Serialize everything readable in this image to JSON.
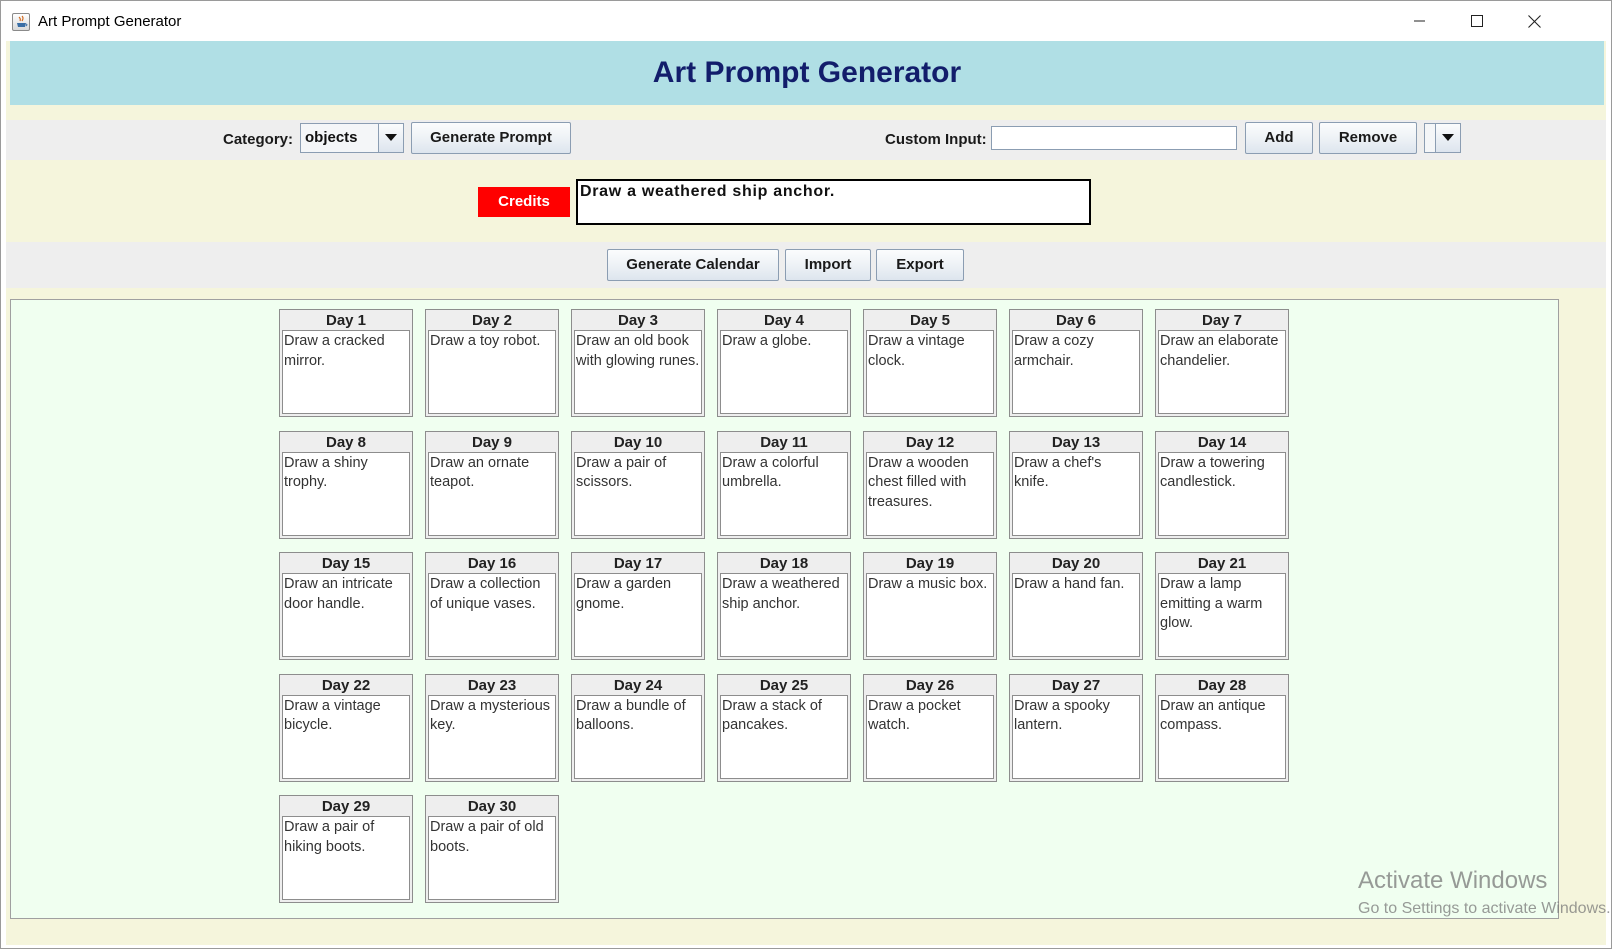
{
  "window": {
    "title": "Art Prompt Generator"
  },
  "header": {
    "title": "Art Prompt Generator"
  },
  "controls": {
    "category_label": "Category:",
    "category_value": "objects",
    "generate_prompt_label": "Generate Prompt",
    "custom_input_label": "Custom Input:",
    "custom_input_value": "",
    "add_label": "Add",
    "remove_label": "Remove"
  },
  "prompt": {
    "credits_label": "Credits",
    "text": "Draw a weathered ship anchor."
  },
  "actions": {
    "generate_calendar_label": "Generate Calendar",
    "import_label": "Import",
    "export_label": "Export"
  },
  "days": [
    {
      "title": "Day 1",
      "text": "Draw a cracked mirror."
    },
    {
      "title": "Day 2",
      "text": "Draw a toy robot."
    },
    {
      "title": "Day 3",
      "text": "Draw an old book with glowing runes."
    },
    {
      "title": "Day 4",
      "text": "Draw a globe."
    },
    {
      "title": "Day 5",
      "text": "Draw a vintage clock."
    },
    {
      "title": "Day 6",
      "text": "Draw a cozy armchair."
    },
    {
      "title": "Day 7",
      "text": "Draw an elaborate chandelier."
    },
    {
      "title": "Day 8",
      "text": "Draw a shiny trophy."
    },
    {
      "title": "Day 9",
      "text": "Draw an ornate teapot."
    },
    {
      "title": "Day 10",
      "text": "Draw a pair of scissors."
    },
    {
      "title": "Day 11",
      "text": "Draw a colorful umbrella."
    },
    {
      "title": "Day 12",
      "text": "Draw a wooden chest filled with treasures."
    },
    {
      "title": "Day 13",
      "text": "Draw a chef's knife."
    },
    {
      "title": "Day 14",
      "text": "Draw a towering candlestick."
    },
    {
      "title": "Day 15",
      "text": "Draw an intricate door handle."
    },
    {
      "title": "Day 16",
      "text": "Draw a collection of unique vases."
    },
    {
      "title": "Day 17",
      "text": "Draw a garden gnome."
    },
    {
      "title": "Day 18",
      "text": "Draw a weathered ship anchor."
    },
    {
      "title": "Day 19",
      "text": "Draw a music box."
    },
    {
      "title": "Day 20",
      "text": "Draw a hand fan."
    },
    {
      "title": "Day 21",
      "text": "Draw a lamp emitting a warm glow."
    },
    {
      "title": "Day 22",
      "text": "Draw a vintage bicycle."
    },
    {
      "title": "Day 23",
      "text": "Draw a mysterious key."
    },
    {
      "title": "Day 24",
      "text": "Draw a bundle of balloons."
    },
    {
      "title": "Day 25",
      "text": "Draw a stack of pancakes."
    },
    {
      "title": "Day 26",
      "text": "Draw a pocket watch."
    },
    {
      "title": "Day 27",
      "text": "Draw a spooky lantern."
    },
    {
      "title": "Day 28",
      "text": "Draw an antique compass."
    },
    {
      "title": "Day 29",
      "text": "Draw a pair of hiking boots."
    },
    {
      "title": "Day 30",
      "text": "Draw a pair of old boots."
    }
  ],
  "watermark": {
    "line1": "Activate Windows",
    "line2": "Go to Settings to activate Windows."
  }
}
